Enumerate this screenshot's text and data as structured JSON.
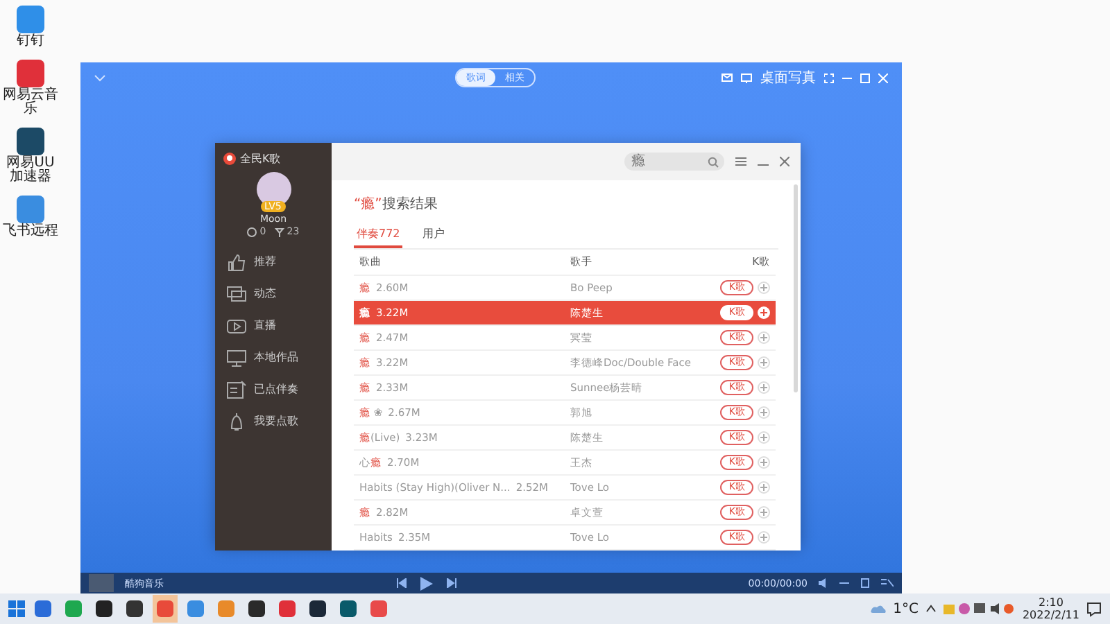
{
  "desktop_icons": [
    {
      "label": "钉钉",
      "color": "#2f8fe8"
    },
    {
      "label": "网易云音乐",
      "color": "#e0303a"
    },
    {
      "label": "网易UU加速器",
      "color": "#1c4a66"
    },
    {
      "label": "飞书远程",
      "color": "#3a8de0"
    }
  ],
  "player_window": {
    "view_toggle": [
      {
        "label": "歌词",
        "selected": true
      },
      {
        "label": "相关",
        "selected": false
      }
    ],
    "desktop_photo": "桌面写真",
    "player_bar": {
      "track": "酷狗音乐",
      "time": "00:00/00:00"
    }
  },
  "app": {
    "logo": "全民K歌",
    "user": {
      "name": "Moon",
      "level": "LV5",
      "followers": "0",
      "gifts": "23"
    },
    "nav": [
      {
        "label": "推荐",
        "kind": "thumb"
      },
      {
        "label": "动态",
        "kind": "chat"
      },
      {
        "label": "直播",
        "kind": "live"
      },
      {
        "label": "本地作品",
        "kind": "monitor"
      },
      {
        "label": "已点伴奏",
        "kind": "list"
      },
      {
        "label": "我要点歌",
        "kind": "bell"
      }
    ],
    "search": {
      "placeholder": "瘾"
    },
    "heading": [
      {
        "text": "“瘾”",
        "hit": true
      },
      {
        "text": "搜索结果",
        "hit": false
      }
    ],
    "tabs": [
      {
        "label": "伴奏772",
        "selected": true
      },
      {
        "label": "用户",
        "selected": false
      }
    ],
    "columns": [
      "歌曲",
      "歌手",
      "K歌"
    ],
    "rows": [
      {
        "title": [
          {
            "text": "瘾",
            "hit": true
          }
        ],
        "size": "2.60M",
        "singer": "Bo Peep",
        "button": "K歌",
        "selected": false
      },
      {
        "title": [
          {
            "text": "瘾",
            "hit": true
          }
        ],
        "size": "3.22M",
        "singer": "陈楚生",
        "button": "K歌",
        "selected": true
      },
      {
        "title": [
          {
            "text": "瘾",
            "hit": true
          }
        ],
        "size": "2.47M",
        "singer": "冥莹",
        "button": "K歌",
        "selected": false
      },
      {
        "title": [
          {
            "text": "瘾",
            "hit": true
          }
        ],
        "size": "3.22M",
        "singer": "李德峰Doc/Double Face",
        "button": "K歌",
        "selected": false
      },
      {
        "title": [
          {
            "text": "瘾",
            "hit": true
          }
        ],
        "size": "2.33M",
        "singer": "Sunnee杨芸晴",
        "button": "K歌",
        "selected": false
      },
      {
        "title": [
          {
            "text": "瘾",
            "hit": true
          },
          {
            "text": " ❀",
            "hit": false
          }
        ],
        "size": "2.67M",
        "singer": "郭旭",
        "button": "K歌",
        "selected": false
      },
      {
        "title": [
          {
            "text": "瘾",
            "hit": true
          },
          {
            "text": "(Live)",
            "hit": false
          }
        ],
        "size": "3.23M",
        "singer": "陈楚生",
        "button": "K歌",
        "selected": false
      },
      {
        "title": [
          {
            "text": "心",
            "hit": false
          },
          {
            "text": "瘾",
            "hit": true
          }
        ],
        "size": "2.70M",
        "singer": "王杰",
        "button": "K歌",
        "selected": false
      },
      {
        "title": [
          {
            "text": "Habits (Stay High)(Oliver N...",
            "hit": false
          }
        ],
        "size": "2.52M",
        "singer": "Tove Lo",
        "button": "K歌",
        "selected": false
      },
      {
        "title": [
          {
            "text": "瘾",
            "hit": true
          }
        ],
        "size": "2.82M",
        "singer": "卓文萱",
        "button": "K歌",
        "selected": false
      },
      {
        "title": [
          {
            "text": "Habits",
            "hit": false
          }
        ],
        "size": "2.35M",
        "singer": "Tove Lo",
        "button": "K歌",
        "selected": false
      }
    ]
  },
  "taskbar": {
    "apps": [
      {
        "color": "#2b6cd8",
        "selected": false
      },
      {
        "color": "#1ea84f",
        "selected": false
      },
      {
        "color": "#222222",
        "selected": false
      },
      {
        "color": "#333333",
        "selected": false
      },
      {
        "color": "#e84a3a",
        "selected": true
      },
      {
        "color": "#3a8de0",
        "selected": false
      },
      {
        "color": "#e88a2a",
        "selected": false
      },
      {
        "color": "#2a2a2a",
        "selected": false
      },
      {
        "color": "#e0303a",
        "selected": false
      },
      {
        "color": "#1b2838",
        "selected": false
      },
      {
        "color": "#0a5a6a",
        "selected": false
      },
      {
        "color": "#e84a4a",
        "selected": false
      }
    ],
    "weather": "1°C",
    "time": "2:10",
    "date": "2022/2/11"
  }
}
